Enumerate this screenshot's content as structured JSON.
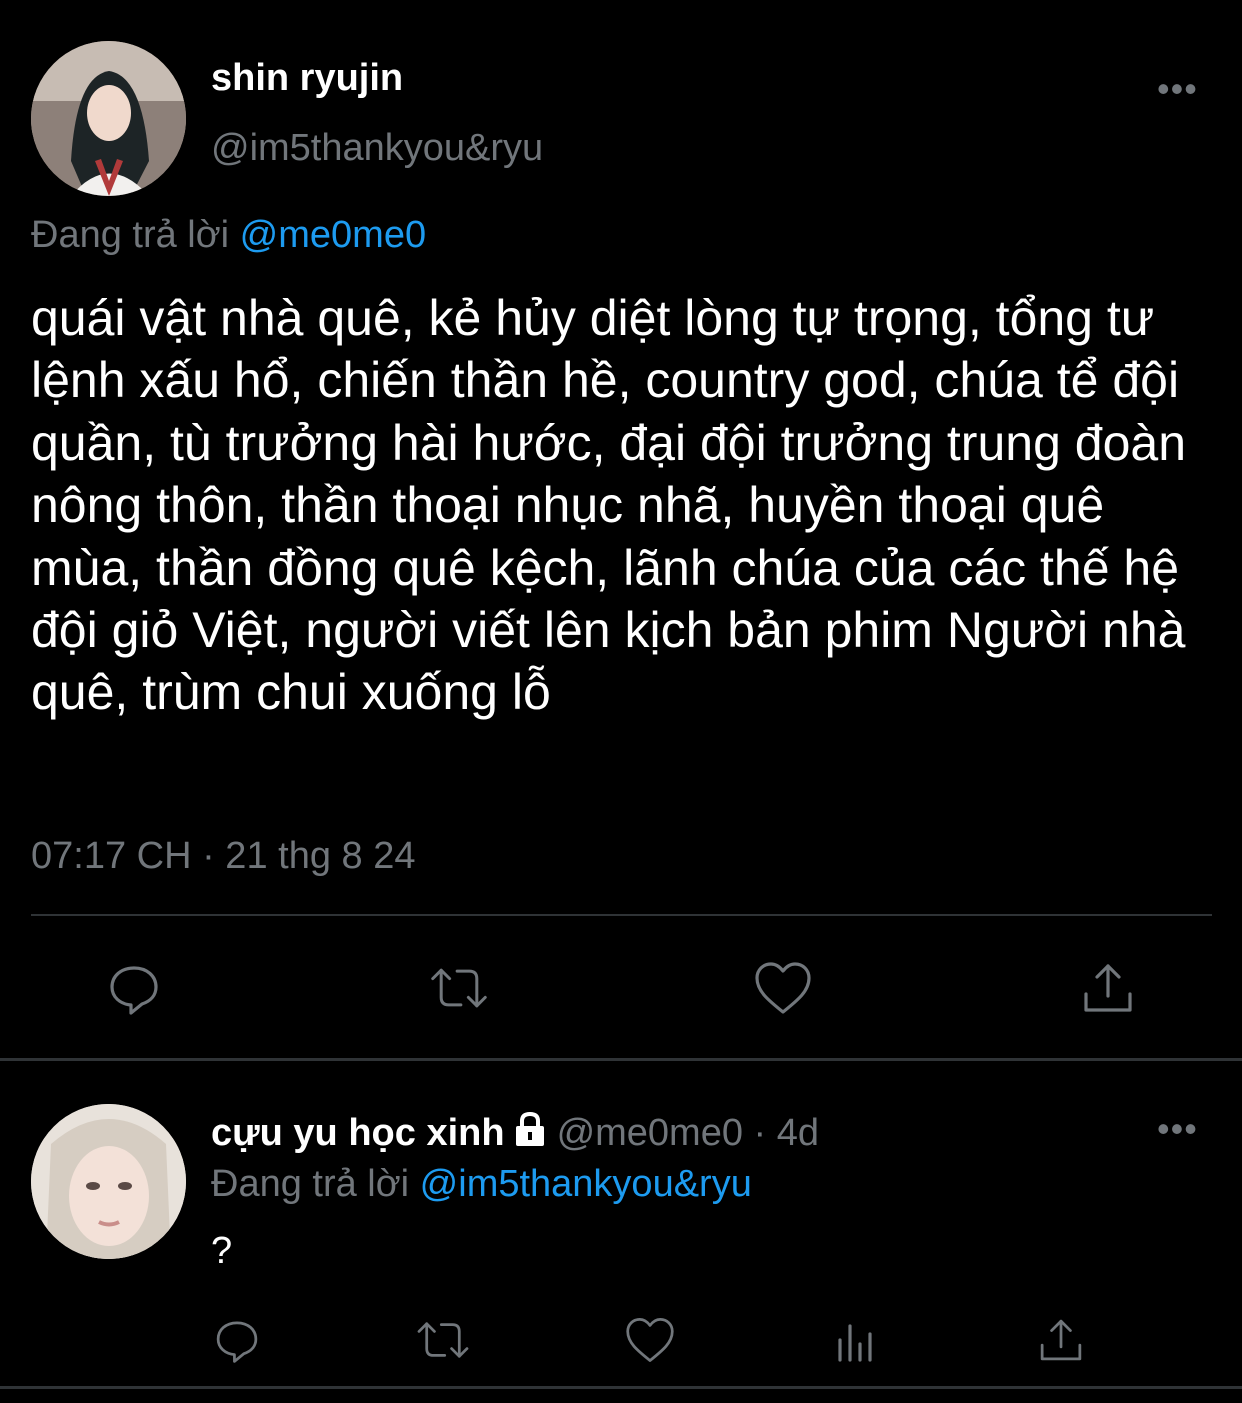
{
  "main_tweet": {
    "display_name": "shin ryujin",
    "handle": "@im5thankyou&ryu",
    "replying_prefix": "Đang trả lời",
    "replying_to": "@me0me0",
    "text": "quái vật nhà quê, kẻ hủy diệt lòng tự trọng, tổng tư lệnh xấu hổ, chiến thần hề, country god, chúa tể đội quần, tù trưởng hài hước, đại đội trưởng trung đoàn nông thôn, thần thoại nhục nhã, huyền thoại quê mùa, thần đồng quê kệch, lãnh chúa của các thế hệ đội giỏ Việt, người viết lên kịch bản phim Người nhà quê, trùm chui xuống lỗ",
    "timestamp": "07:17 CH · 21 thg 8 24",
    "more_label": "•••",
    "actions": [
      "reply-icon",
      "retweet-icon",
      "like-icon",
      "share-icon"
    ]
  },
  "reply_tweet": {
    "display_name": "cựu yu học xinh",
    "handle": "@me0me0",
    "separator": "·",
    "age": "4d",
    "replying_prefix": "Đang trả lời",
    "replying_to": "@im5thankyou&ryu",
    "text": "?",
    "more_label": "•••",
    "actions": [
      "reply-icon",
      "retweet-icon",
      "like-icon",
      "analytics-icon",
      "share-icon"
    ]
  },
  "colors": {
    "background": "#000000",
    "text_primary": "#ffffff",
    "text_secondary": "#71767b",
    "link": "#1d9bf0",
    "divider": "#2f3336"
  }
}
